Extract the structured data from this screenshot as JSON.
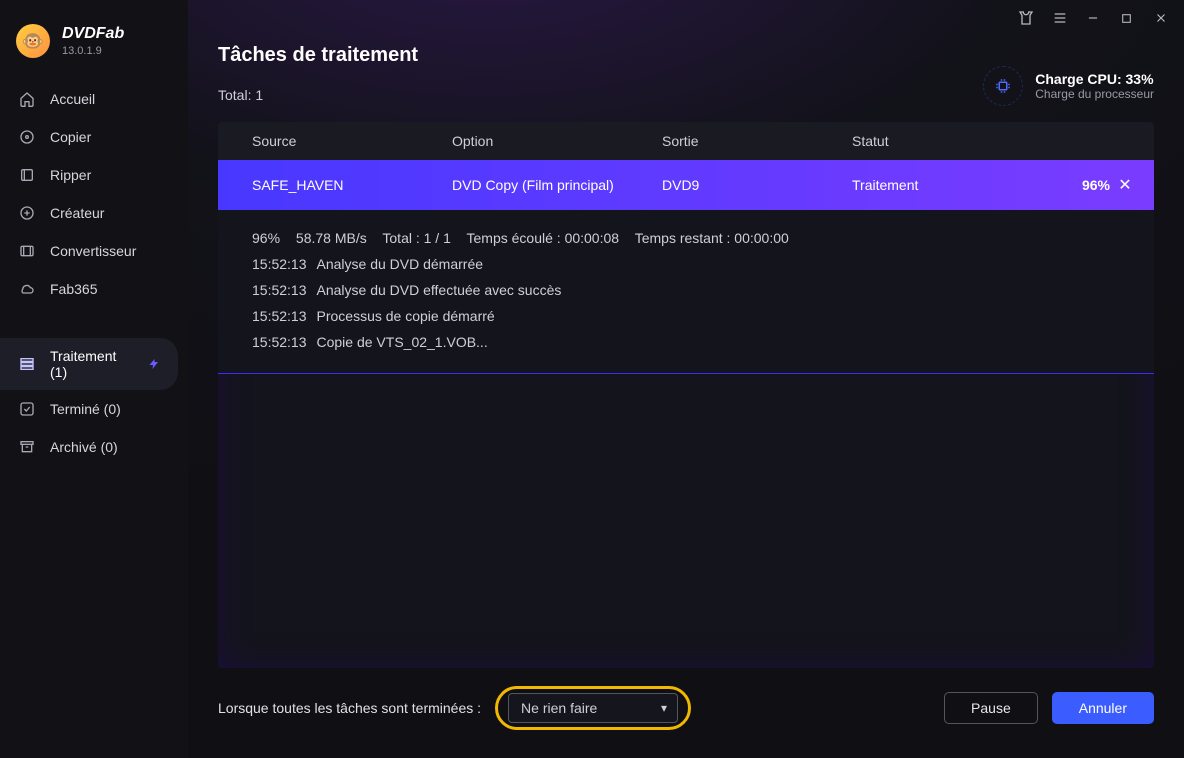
{
  "brand": {
    "name": "DVDFab",
    "version": "13.0.1.9"
  },
  "sidebar": {
    "items": [
      {
        "label": "Accueil"
      },
      {
        "label": "Copier"
      },
      {
        "label": "Ripper"
      },
      {
        "label": "Créateur"
      },
      {
        "label": "Convertisseur"
      },
      {
        "label": "Fab365"
      }
    ],
    "status": [
      {
        "label": "Traitement (1)"
      },
      {
        "label": "Terminé (0)"
      },
      {
        "label": "Archivé (0)"
      }
    ]
  },
  "header": {
    "title": "Tâches de traitement",
    "total_label": "Total: 1"
  },
  "cpu": {
    "title": "Charge CPU: 33%",
    "subtitle": "Charge du processeur"
  },
  "columns": {
    "source": "Source",
    "option": "Option",
    "sortie": "Sortie",
    "statut": "Statut"
  },
  "task": {
    "source": "SAFE_HAVEN",
    "option": "DVD Copy (Film principal)",
    "sortie": "DVD9",
    "statut": "Traitement",
    "percent": "96%"
  },
  "details": {
    "pct": "96%",
    "speed": "58.78 MB/s",
    "total": "Total : 1 / 1",
    "elapsed": "Temps écoulé : 00:00:08",
    "remaining": "Temps restant : 00:00:00"
  },
  "log": [
    {
      "ts": "15:52:13",
      "msg": "Analyse du DVD démarrée"
    },
    {
      "ts": "15:52:13",
      "msg": "Analyse du DVD effectuée avec succès"
    },
    {
      "ts": "15:52:13",
      "msg": "Processus de copie démarré"
    },
    {
      "ts": "15:52:13",
      "msg": "Copie de VTS_02_1.VOB..."
    }
  ],
  "footer": {
    "label": "Lorsque toutes les tâches sont terminées :",
    "select_value": "Ne rien faire",
    "pause": "Pause",
    "cancel": "Annuler"
  }
}
